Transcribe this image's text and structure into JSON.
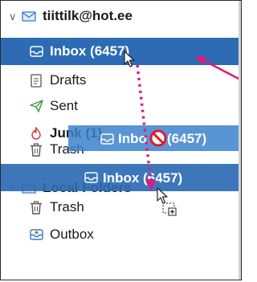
{
  "account": {
    "name": "tiittilk@hot.ee",
    "icon": "mail-account-icon"
  },
  "folders": [
    {
      "label": "Inbox (6457)",
      "icon": "inbox-icon",
      "selected": true
    },
    {
      "label": "Drafts",
      "icon": "drafts-icon"
    },
    {
      "label": "Sent",
      "icon": "sent-icon"
    },
    {
      "label": "Junk (1)",
      "icon": "junk-icon"
    },
    {
      "label": "Trash",
      "icon": "trash-icon"
    }
  ],
  "local_folders": {
    "name": "Local Folders",
    "icon": "folder-icon"
  },
  "local_items": [
    {
      "label": "Trash",
      "icon": "trash-icon"
    },
    {
      "label": "Outbox",
      "icon": "outbox-icon"
    }
  ],
  "drag_ghost_mid": {
    "prefix": "Inbo",
    "suffix": "(6457)"
  },
  "drag_ghost_bottom": {
    "label": "Inbox (6457)"
  },
  "colors": {
    "selected": "#2d6bb4",
    "ghost": "#3c82cd",
    "annotation": "#e0197f"
  }
}
